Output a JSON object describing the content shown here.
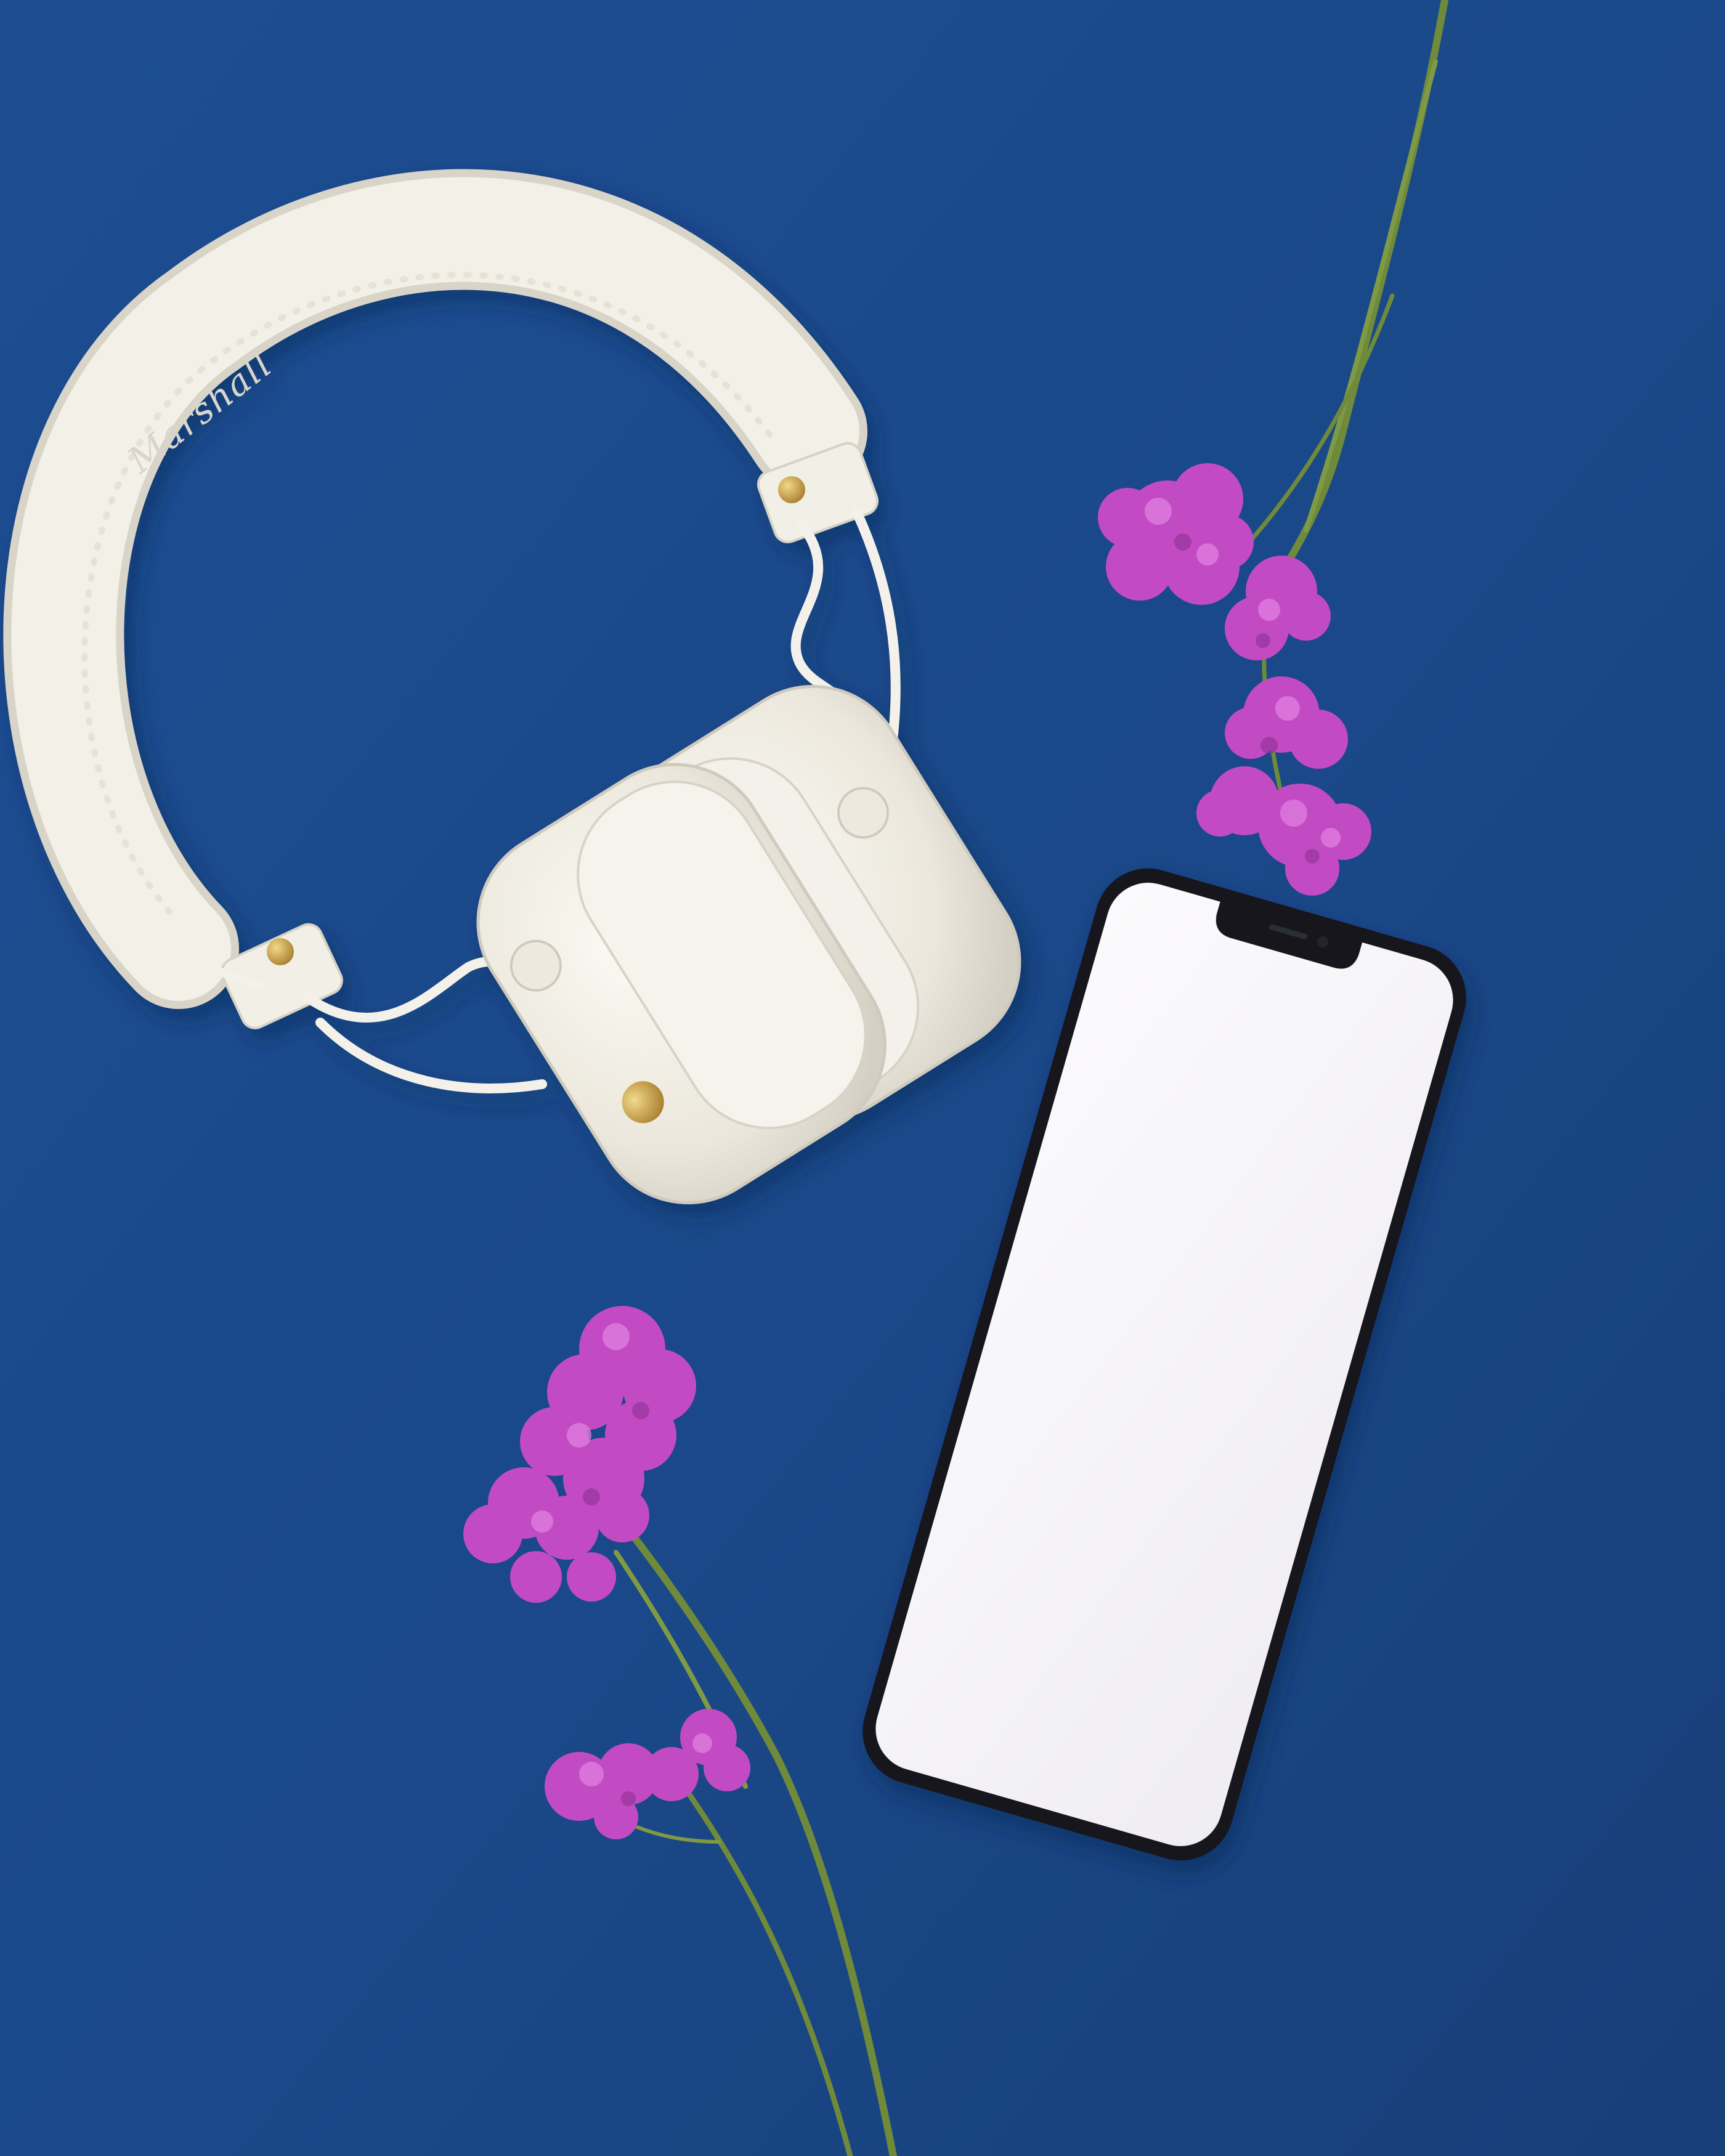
{
  "scene": {
    "background_color": "#1b4a8c",
    "headphones": {
      "brand_logo": "Marshall",
      "color": "#f1eee6",
      "hardware_color": "#c9a24a"
    },
    "smartphone": {
      "screen_color": "#f6f4f8",
      "frame_color": "#16181c"
    },
    "flowers": {
      "petal_color": "#c24bc4",
      "stem_color": "#6f8a3a"
    }
  }
}
